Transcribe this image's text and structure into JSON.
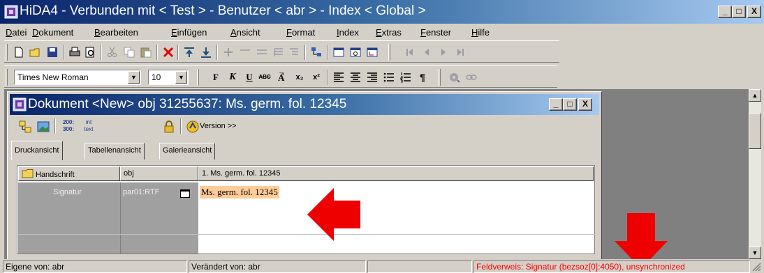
{
  "window": {
    "title": "HiDA4 - Verbunden mit < Test > - Benutzer < abr > - Index < Global >",
    "min_label": "_",
    "max_label": "□",
    "close_label": "X"
  },
  "menu": [
    "Datei",
    "Dokument",
    "Bearbeiten",
    "Einfügen",
    "Ansicht",
    "Format",
    "Index",
    "Extras",
    "Fenster",
    "Hilfe"
  ],
  "format_toolbar": {
    "font": "Times New Roman",
    "size": "10",
    "bold": "F",
    "italic": "K",
    "underline": "U",
    "strike": "ABC",
    "subscript": "x₂",
    "superscript": "x²",
    "paragraph": "¶"
  },
  "document_window": {
    "title": "Dokument <New> obj 31255637: Ms. germ. fol. 12345",
    "zoom_top": "200:",
    "zoom_bottom": "300:",
    "int_top": "int",
    "int_bottom": "text",
    "version_label": "Version >>",
    "tabs": [
      "Druckansicht",
      "Tabellenansicht",
      "Galerieansicht"
    ],
    "active_tab": "Druckansicht"
  },
  "grid": {
    "headers": [
      "Handschrift",
      "obj",
      "1. Ms. germ. fol. 12345"
    ],
    "row": {
      "field": "Signatur",
      "ref": "par01:RTF",
      "value": "Ms. germ. fol. 12345"
    }
  },
  "statusbar": {
    "owner": "Eigene von: abr",
    "modified": "Verändert von: abr",
    "field_ref": "Feldverweis: Signatur (bezsoz[0]:4050), unsynchronized"
  },
  "colors": {
    "accent": "#0a246a",
    "highlight": "#ffcc99",
    "arrow": "#ee0000",
    "status_red": "#ff0000"
  }
}
